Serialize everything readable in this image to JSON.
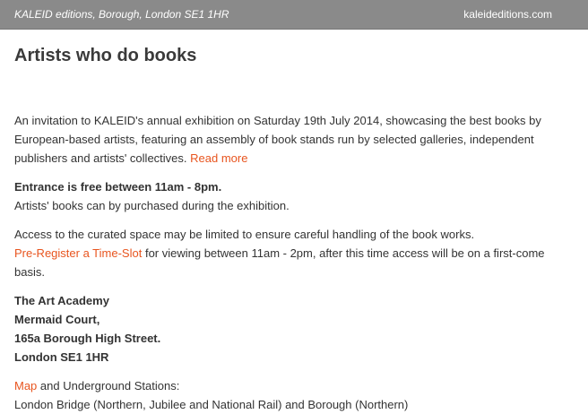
{
  "header": {
    "left_text": "KALEID editions, Borough, London SE1 1HR",
    "right_link": "kaleideditions.com"
  },
  "page_title": "Artists who do books",
  "intro": {
    "text": "An invitation to KALEID's annual exhibition on Saturday 19th July 2014, showcasing the best books by European-based artists, featuring an assembly of book stands run by selected galleries, independent publishers and artists' collectives.",
    "read_more": "Read more"
  },
  "entrance": {
    "heading": "Entrance is free between 11am - 8pm.",
    "note": "Artists' books can by purchased during the exhibition."
  },
  "access": {
    "line1": "Access to the curated space may be limited to ensure careful handling of the book works.",
    "register_link": "Pre-Register a Time-Slot",
    "line2": "for viewing between 11am - 2pm, after this time access will be on a first-come basis."
  },
  "address": {
    "line1": "The Art Academy",
    "line2": "Mermaid Court,",
    "line3": "165a Borough High Street.",
    "line4": "London SE1 1HR"
  },
  "transport": {
    "map_link": "Map",
    "label": "and Underground Stations:",
    "stations": "London Bridge (Northern, Jubilee and National Rail) and Borough (Northern)"
  },
  "colors": {
    "header_bg": "#8a8a8a",
    "link": "#e8551f",
    "text": "#333333"
  }
}
